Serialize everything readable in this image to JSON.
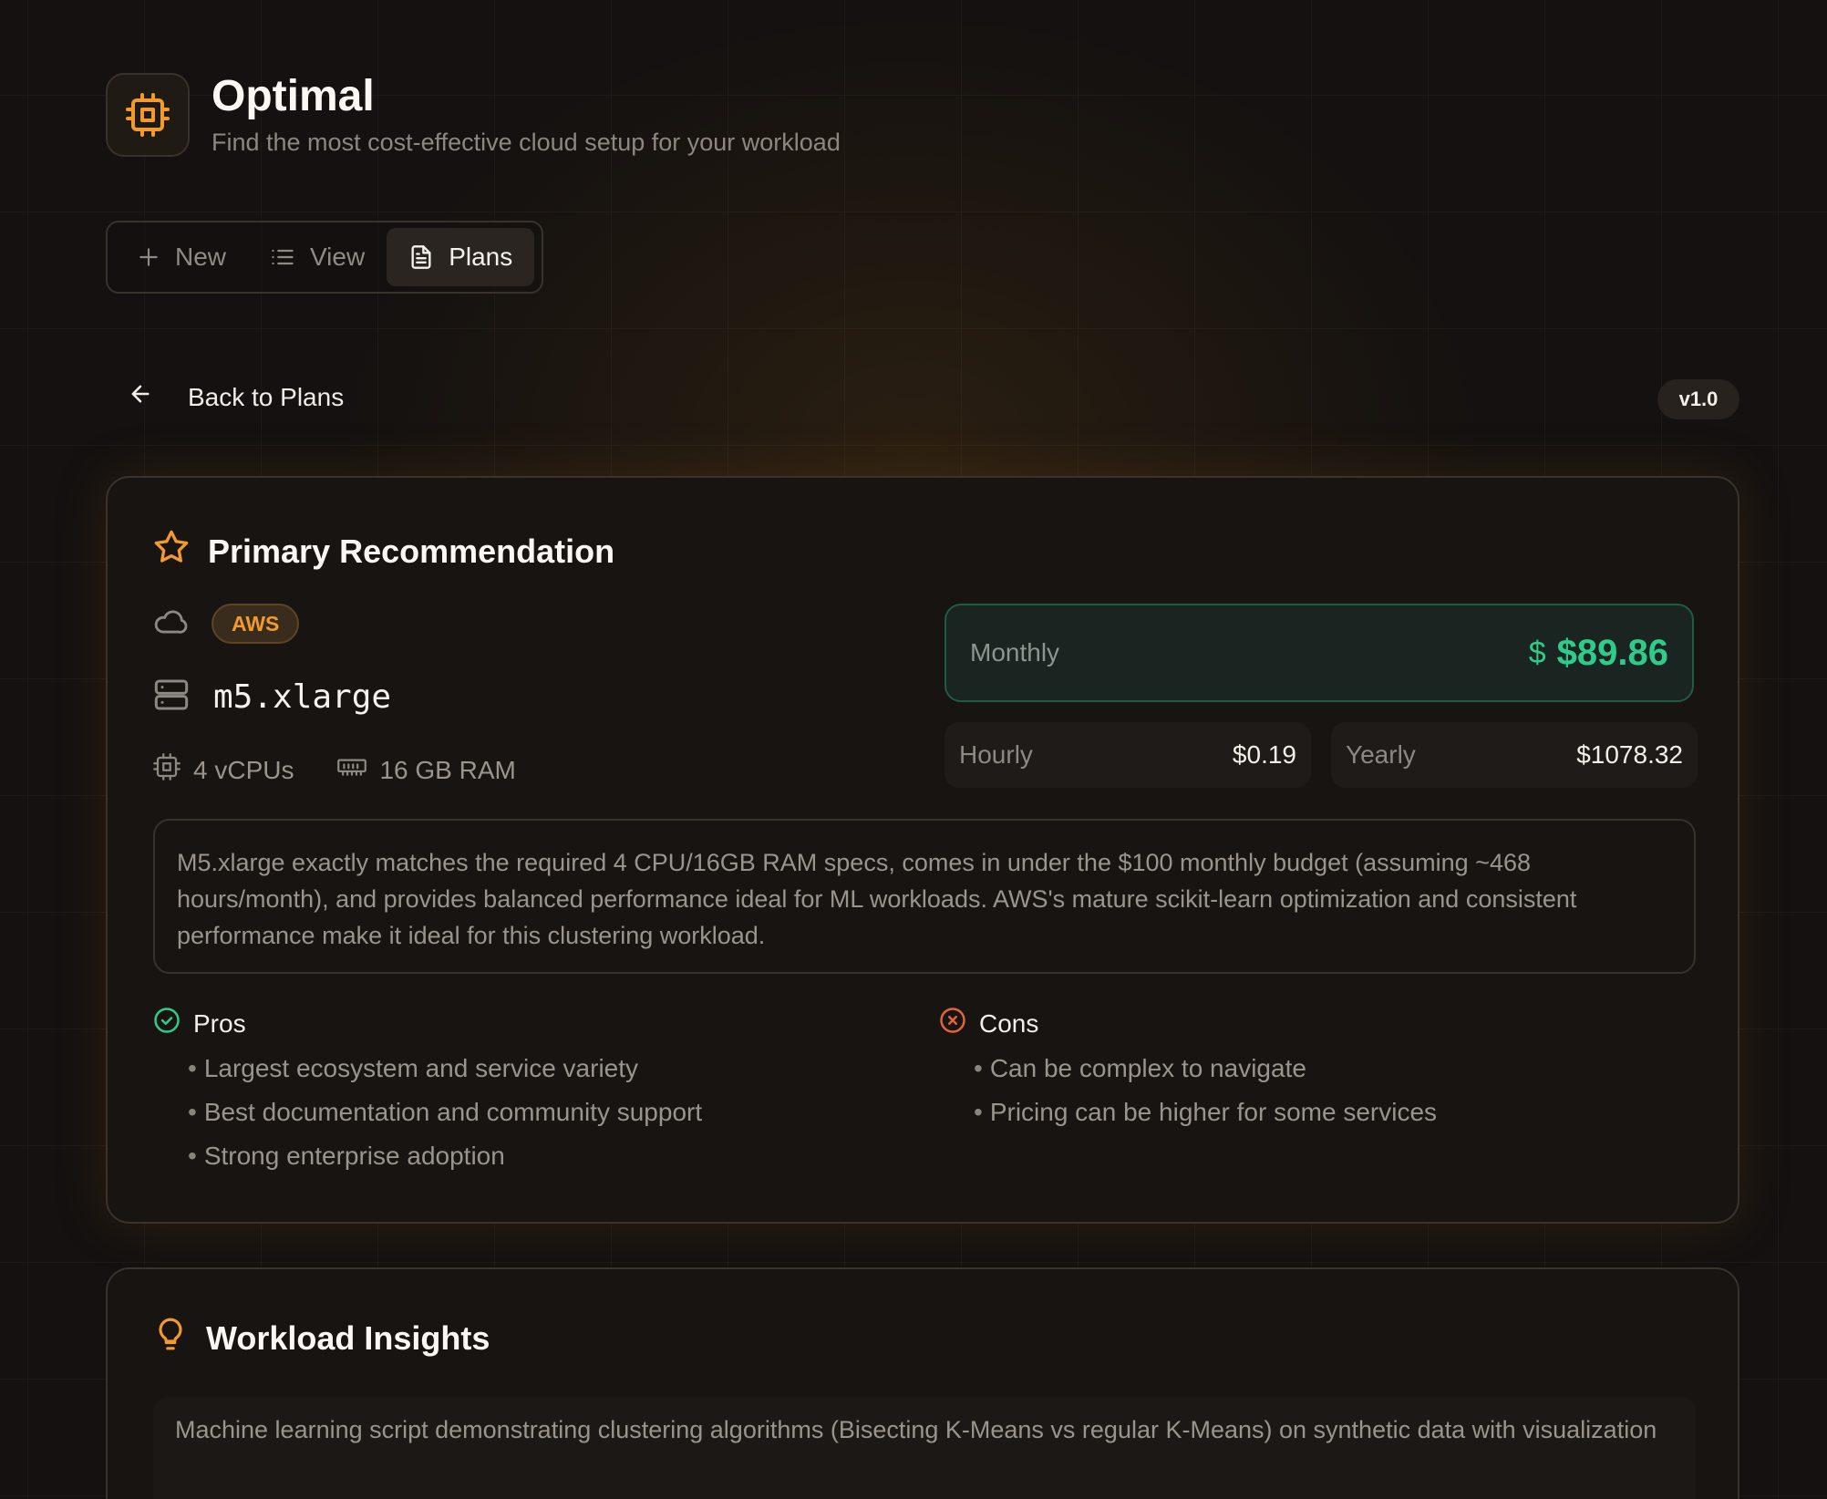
{
  "app": {
    "title": "Optimal",
    "subtitle": "Find the most cost-effective cloud setup for your workload"
  },
  "tabs": [
    {
      "label": "New",
      "icon": "plus-icon"
    },
    {
      "label": "View",
      "icon": "list-icon"
    },
    {
      "label": "Plans",
      "icon": "document-icon",
      "active": true
    }
  ],
  "nav": {
    "back_label": "Back to Plans",
    "version": "v1.0"
  },
  "recommendation": {
    "title": "Primary Recommendation",
    "provider": "AWS",
    "instance": "m5.xlarge",
    "cpu": "4 vCPUs",
    "ram": "16 GB RAM",
    "pricing": {
      "monthly_label": "Monthly",
      "monthly_value": "$89.86",
      "currency_symbol": "$",
      "hourly_label": "Hourly",
      "hourly_value": "$0.19",
      "yearly_label": "Yearly",
      "yearly_value": "$1078.32"
    },
    "reasoning": "M5.xlarge exactly matches the required 4 CPU/16GB RAM specs, comes in under the $100 monthly budget (assuming ~468 hours/month), and provides balanced performance ideal for ML workloads. AWS's mature scikit-learn optimization and consistent performance make it ideal for this clustering workload.",
    "pros_label": "Pros",
    "pros": [
      "Largest ecosystem and service variety",
      "Best documentation and community support",
      "Strong enterprise adoption"
    ],
    "cons_label": "Cons",
    "cons": [
      "Can be complex to navigate",
      "Pricing can be higher for some services"
    ]
  },
  "insights": {
    "title": "Workload Insights",
    "text": "Machine learning script demonstrating clustering algorithms (Bisecting K-Means vs regular K-Means) on synthetic data with visualization"
  },
  "colors": {
    "accent": "#f29a2e",
    "success": "#2fcb8a",
    "danger": "#e0653a",
    "background": "#141110"
  }
}
